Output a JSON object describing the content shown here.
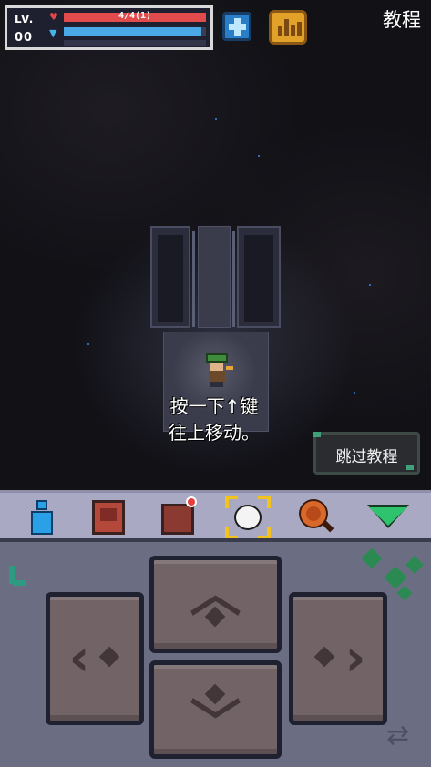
{
  "hud": {
    "level_label": "LV.",
    "level_value": "00",
    "hp_text": "4/4(1)",
    "hp_fraction": 1.0,
    "mp_fraction": 0.97,
    "icons": {
      "hp": "heart-icon",
      "mp": "mana-drop-icon"
    }
  },
  "header": {
    "title": "教程",
    "heal_button_icon": "plus-icon",
    "stats_button_icon": "bar-chart-icon"
  },
  "tutorial": {
    "hint_line1": "按一下↑键",
    "hint_line2": "往上移动。",
    "skip_label": "跳过教程"
  },
  "toolbar": {
    "items": [
      {
        "name": "character",
        "icon": "character-icon"
      },
      {
        "name": "inventory",
        "icon": "inventory-icon"
      },
      {
        "name": "backpack",
        "icon": "backpack-icon",
        "has_notification": true
      },
      {
        "name": "focus",
        "icon": "focus-target-icon",
        "selected": true
      },
      {
        "name": "search",
        "icon": "magnifier-icon"
      },
      {
        "name": "collapse",
        "icon": "chevron-down-icon"
      }
    ]
  },
  "controls": {
    "up_icon": "arrow-up-icon",
    "down_icon": "arrow-down-icon",
    "left_icon": "arrow-left-icon",
    "right_icon": "arrow-right-icon",
    "swap_icon": "swap-icon"
  },
  "colors": {
    "hp": "#e24b4b",
    "mp": "#4aa8e6",
    "toolbar_bg": "#a9a9c3",
    "controls_bg": "#6b6e83",
    "dpad_button": "#726466",
    "focus_accent": "#f2c21f"
  }
}
